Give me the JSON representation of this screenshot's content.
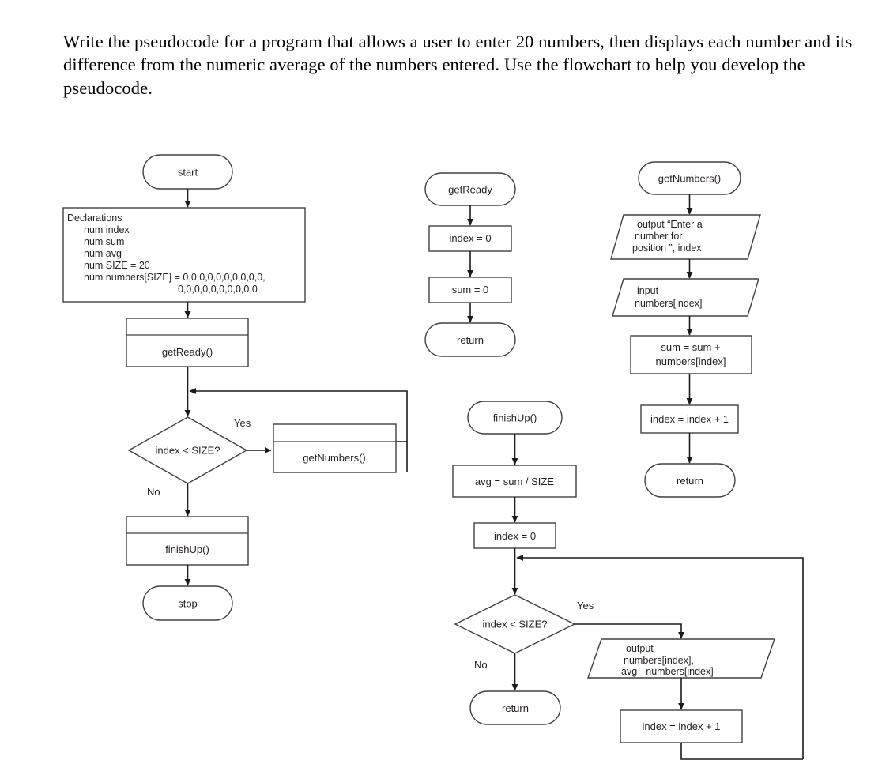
{
  "prompt": {
    "text": "Write the pseudocode for a program that allows a user to enter 20 numbers, then displays each number and its difference from the numeric average of the numbers entered. Use the flowchart to help you develop the pseudocode."
  },
  "colors": {
    "background": "#ffffff",
    "stroke": "#1a1a1a",
    "stroke_light": "#404040",
    "text": "#231f20"
  },
  "flowchart": {
    "main": {
      "start": "start",
      "declarations": {
        "header": "Declarations",
        "lines": [
          "num index",
          "num sum",
          "num avg",
          "num SIZE = 20",
          "num numbers[SIZE] = 0,0,0,0,0,0,0,0,0,0,",
          "0,0,0,0,0,0,0,0,0,0"
        ]
      },
      "get_ready_call": "getReady()",
      "decision": "index < SIZE?",
      "decision_yes": "Yes",
      "decision_no": "No",
      "get_numbers_call": "getNumbers()",
      "finish_up_call": "finishUp()",
      "stop": "stop"
    },
    "get_ready": {
      "title": "getReady",
      "step_index": "index = 0",
      "step_sum": "sum = 0",
      "return": "return"
    },
    "get_numbers": {
      "title": "getNumbers()",
      "output_lines": [
        "output “Enter a",
        "number for",
        "position ”, index"
      ],
      "input_lines": [
        "input",
        "numbers[index]"
      ],
      "sum_lines": [
        "sum = sum +",
        "numbers[index]"
      ],
      "increment": "index = index + 1",
      "return": "return"
    },
    "finish_up": {
      "title": "finishUp()",
      "avg": "avg = sum / SIZE",
      "index_init": "index = 0",
      "decision": "index < SIZE?",
      "decision_yes": "Yes",
      "decision_no": "No",
      "output_lines": [
        "output",
        "numbers[index],",
        "avg - numbers[index]"
      ],
      "increment": "index = index + 1",
      "return": "return"
    }
  }
}
